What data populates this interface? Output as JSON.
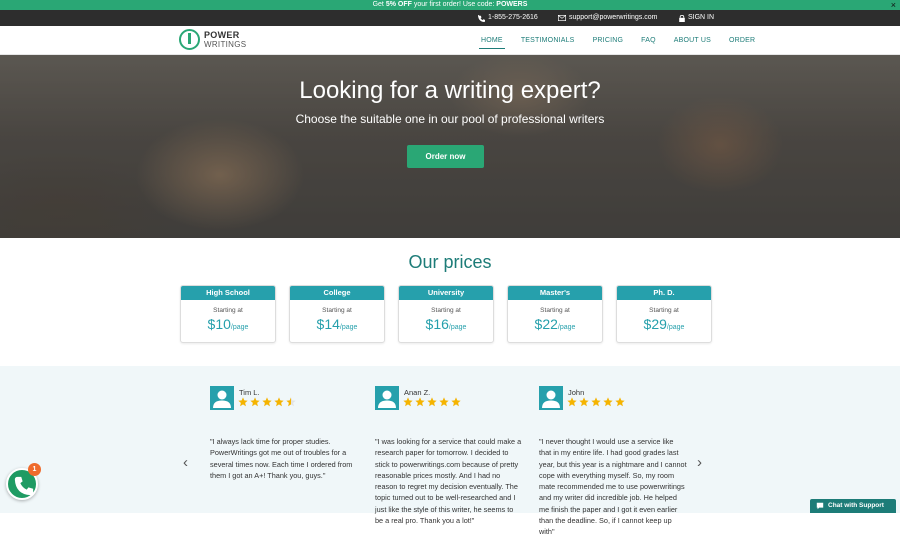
{
  "promo": {
    "prefix": "Get ",
    "highlight": "5% OFF",
    "middle": " your first order! Use code: ",
    "code": "POWERS",
    "close_label": "×"
  },
  "contact": {
    "phone": "1-855-275-2616",
    "email": "support@powerwritings.com",
    "signin": "SIGN IN"
  },
  "logo": {
    "line1": "POWER",
    "line2": "WRITINGS"
  },
  "nav": {
    "items": [
      {
        "label": "HOME",
        "active": true
      },
      {
        "label": "TESTIMONIALS",
        "active": false
      },
      {
        "label": "PRICING",
        "active": false
      },
      {
        "label": "FAQ",
        "active": false
      },
      {
        "label": "ABOUT US",
        "active": false
      },
      {
        "label": "ORDER",
        "active": false
      }
    ]
  },
  "hero": {
    "title": "Looking for a writing expert?",
    "subtitle": "Choose the suitable one in our pool of professional writers",
    "cta": "Order now"
  },
  "prices": {
    "title": "Our prices",
    "cards": [
      {
        "level": "High School",
        "starting": "Starting at",
        "price": "$10",
        "unit": "/page"
      },
      {
        "level": "College",
        "starting": "Starting at",
        "price": "$14",
        "unit": "/page"
      },
      {
        "level": "University",
        "starting": "Starting at",
        "price": "$16",
        "unit": "/page"
      },
      {
        "level": "Master's",
        "starting": "Starting at",
        "price": "$22",
        "unit": "/page"
      },
      {
        "level": "Ph. D.",
        "starting": "Starting at",
        "price": "$29",
        "unit": "/page"
      }
    ]
  },
  "reviews": [
    {
      "name": "Tim L.",
      "rating": 4.5,
      "text": "\"I always lack time for proper studies. PowerWritings got me out of troubles for a several times now. Each time I ordered from them I got an A+! Thank you, guys.\""
    },
    {
      "name": "Anan Z.",
      "rating": 5,
      "text": "\"I was looking for a service that could make a research paper for tomorrow. I decided to stick to powerwritings.com because of pretty reasonable prices mostly. And I had no reason to regret my decision eventually. The topic turned out to be well-researched and I just like the style of this writer, he seems to be a real pro. Thank you a lot!\""
    },
    {
      "name": "John",
      "rating": 5,
      "text": "\"I never thought I would use a service like that in my entire life. I had good grades last year, but this year is a nightmare and I cannot cope with everything myself. So, my room mate recommended me to use powerwritings and my writer did incredible job. He helped me finish the paper and I got it even earlier than the deadline. So, if I cannot keep up with\""
    }
  ],
  "carousel": {
    "prev": "‹",
    "next": "›"
  },
  "widgets": {
    "badge_count": "1",
    "chat_label": "Chat with Support"
  },
  "colors": {
    "accent_green": "#2aa775",
    "teal": "#26a0ac",
    "star": "#f5b400"
  }
}
